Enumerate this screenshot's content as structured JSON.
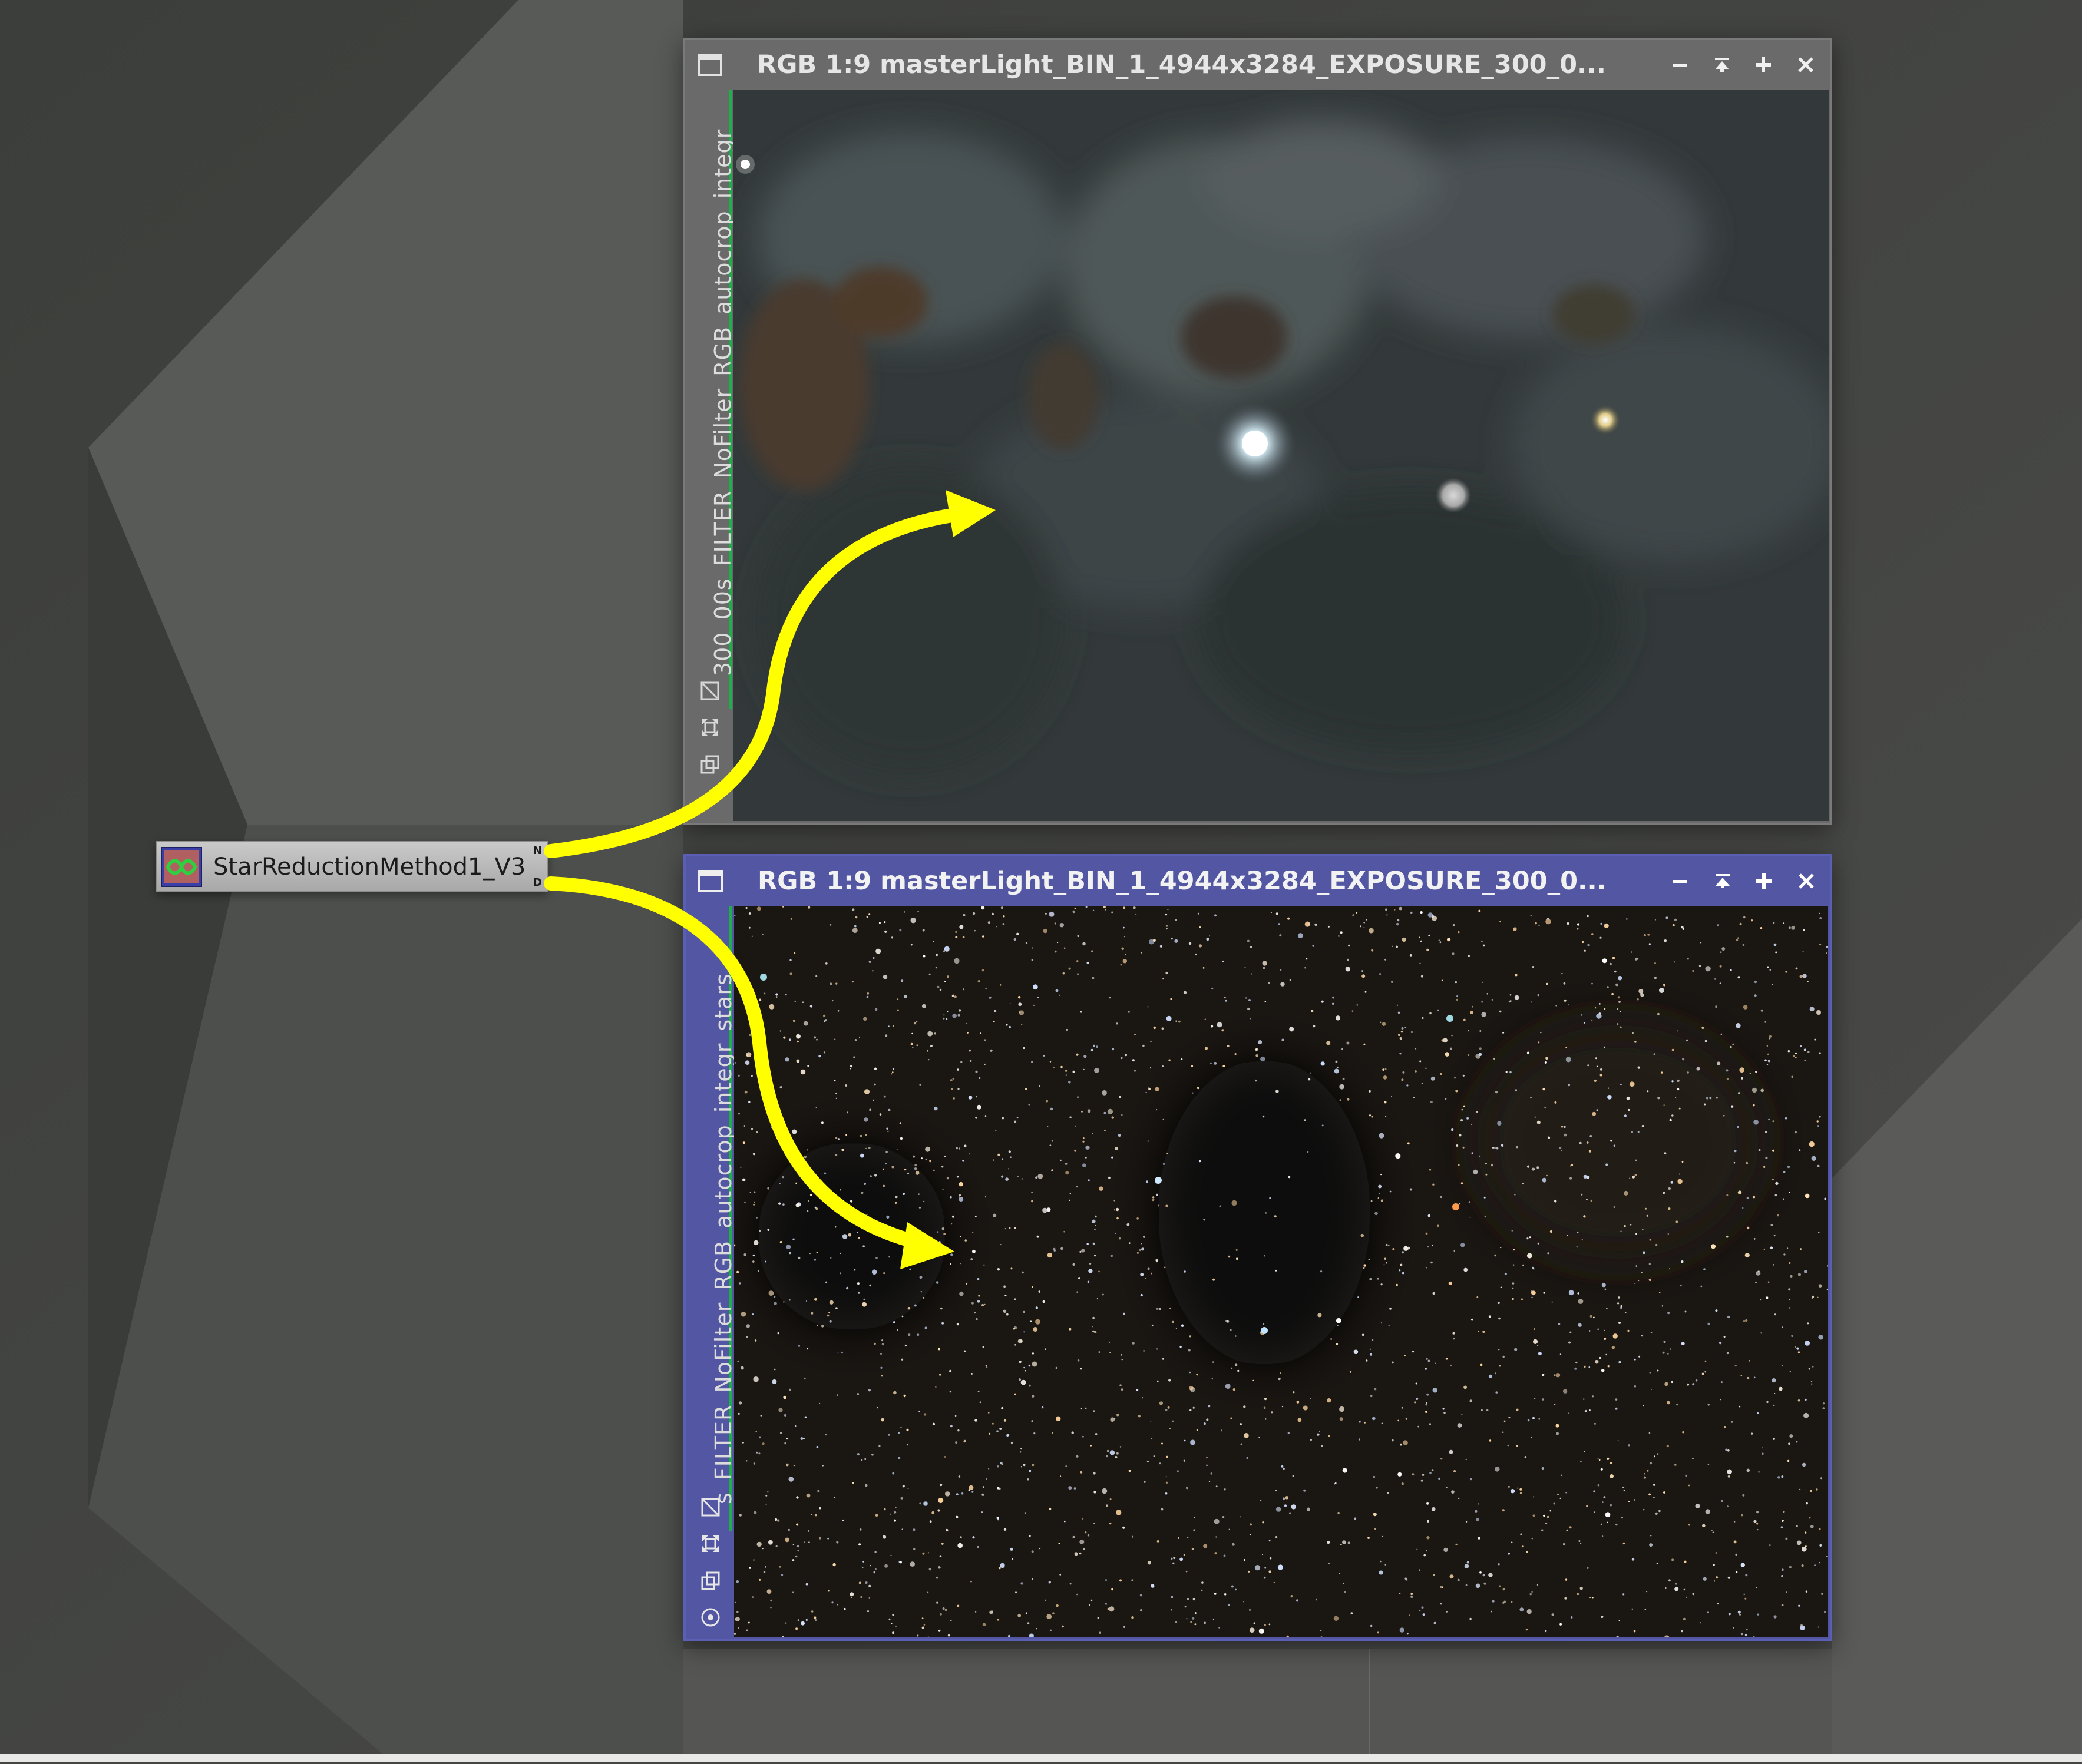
{
  "process_icon": {
    "label": "StarReductionMethod1_V3",
    "flag_n": "N",
    "flag_d": "D"
  },
  "windows": [
    {
      "title": "RGB 1:9 masterLight_BIN_1_4944x3284_EXPOSURE_300_0...",
      "side_label": "300_00s_FILTER_NoFilter_RGB_autocrop_integr",
      "content": "starless-nebula"
    },
    {
      "title": "RGB 1:9 masterLight_BIN_1_4944x3284_EXPOSURE_300_0...",
      "side_label": "s_FILTER_NoFilter_RGB_autocrop_integr_stars",
      "content": "stars-only"
    }
  ],
  "colors": {
    "workspace": "#434541",
    "active_title": "#5357a3",
    "inactive_title": "#6a6a6a",
    "arrow": "#ffff00",
    "channel_line": "#1fae4a"
  },
  "icons": {
    "window_menu": "window-icon",
    "minimize": "minimize-icon",
    "shade": "shade-icon",
    "maximize": "maximize-icon",
    "close": "close-icon"
  }
}
